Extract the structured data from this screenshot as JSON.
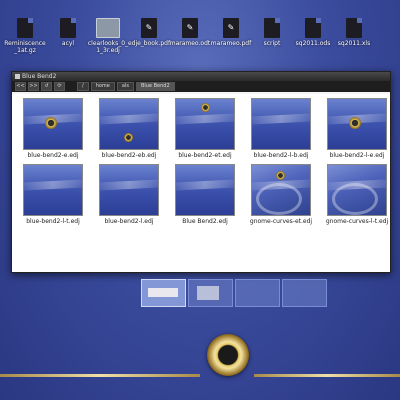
{
  "desktop_icons": [
    {
      "label": "Reminiscence_1at.gz",
      "kind": "doc"
    },
    {
      "label": "acyl",
      "kind": "doc"
    },
    {
      "label": "clearlooks_0_1_3r.edj",
      "kind": "thumb"
    },
    {
      "label": "edje_book.pdf",
      "kind": "pdf"
    },
    {
      "label": "marameo.odt",
      "kind": "pdf"
    },
    {
      "label": "marameo.pdf",
      "kind": "pdf"
    },
    {
      "label": "script",
      "kind": "doc"
    },
    {
      "label": "sq2011.ods",
      "kind": "doc"
    },
    {
      "label": "sq2011.xls",
      "kind": "doc"
    }
  ],
  "window": {
    "title": "Blue Bend2",
    "toolbar": {
      "buttons": [
        "<<",
        ">>",
        "↺",
        "⟳"
      ],
      "path": [
        "/",
        "home",
        "als",
        "Blue Bend2"
      ]
    },
    "files": [
      {
        "label": "blue-bend2-e.edj",
        "emblem": "center",
        "style": "plain"
      },
      {
        "label": "blue-bend2-eb.edj",
        "emblem": "bottom",
        "style": "plain"
      },
      {
        "label": "blue-bend2-et.edj",
        "emblem": "top",
        "style": "plain"
      },
      {
        "label": "blue-bend2-l-b.edj",
        "emblem": "none",
        "style": "plain"
      },
      {
        "label": "blue-bend2-l-e.edj",
        "emblem": "center",
        "style": "plain"
      },
      {
        "label": "blue-bend2-l-t.edj",
        "emblem": "none",
        "style": "plain"
      },
      {
        "label": "blue-bend2-l.edj",
        "emblem": "none",
        "style": "plain"
      },
      {
        "label": "Blue Bend2.edj",
        "emblem": "none",
        "style": "plain"
      },
      {
        "label": "gnome-curves-et.edj",
        "emblem": "top",
        "style": "curves"
      },
      {
        "label": "gnome-curves-l-t.edj",
        "emblem": "none",
        "style": "curves"
      }
    ]
  },
  "pager": {
    "pages": 4,
    "active": 0
  }
}
